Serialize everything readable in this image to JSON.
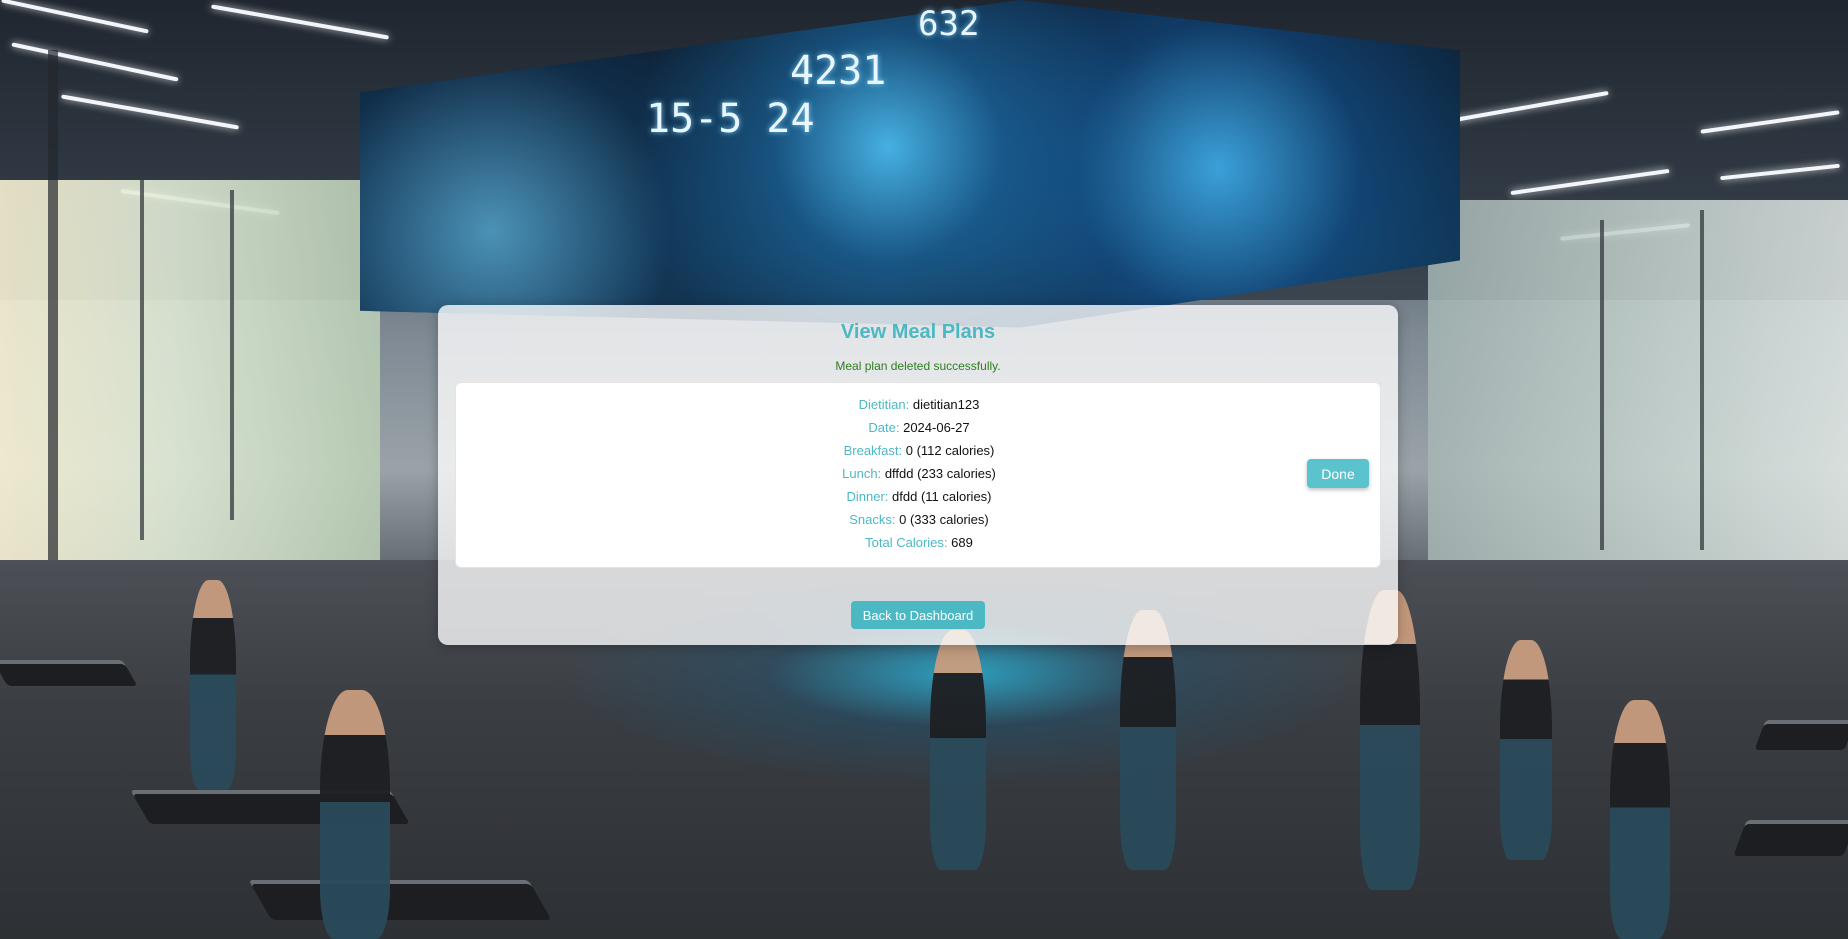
{
  "page": {
    "title": "View Meal Plans",
    "message": "Meal plan deleted successfully."
  },
  "meal_plan": {
    "dietitian_label": "Dietitian:",
    "dietitian": "dietitian123",
    "date_label": "Date:",
    "date": "2024-06-27",
    "breakfast_label": "Breakfast:",
    "breakfast": "0 (112 calories)",
    "lunch_label": "Lunch:",
    "lunch": "dffdd (233 calories)",
    "dinner_label": "Dinner:",
    "dinner": "dfdd (11 calories)",
    "snacks_label": "Snacks:",
    "snacks": "0 (333 calories)",
    "total_label": "Total Calories:",
    "total": "689",
    "done_label": "Done"
  },
  "actions": {
    "back_label": "Back to Dashboard"
  },
  "background": {
    "screen_numbers": [
      "15-5 24",
      "4231",
      "632"
    ]
  },
  "colors": {
    "accent": "#4cb8c4",
    "success": "#2e7d1e",
    "button": "#5bc3cd"
  }
}
